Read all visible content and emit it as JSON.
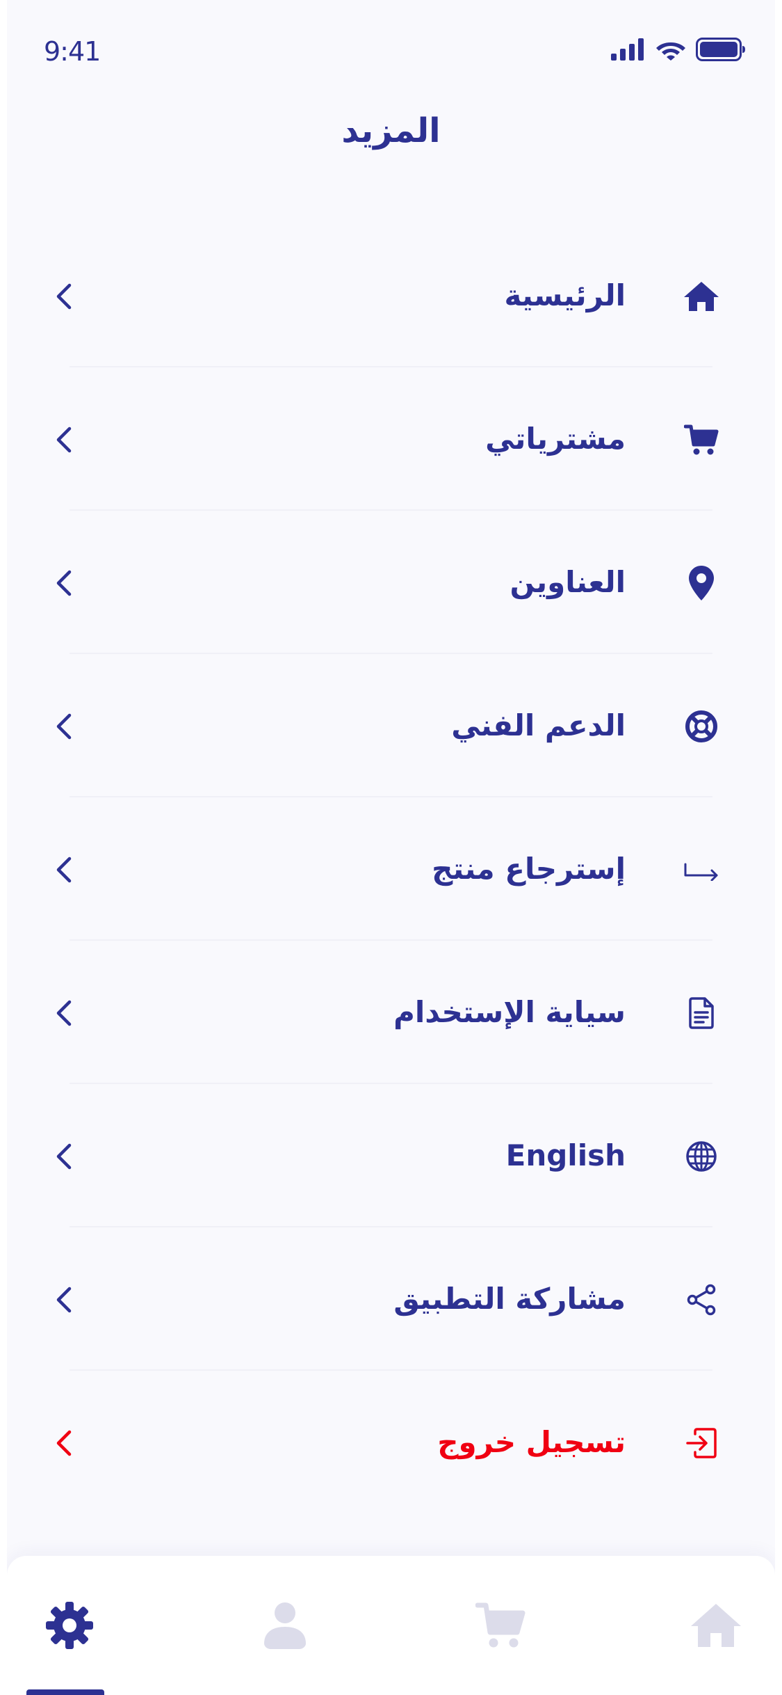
{
  "status_bar": {
    "time": "9:41",
    "signal_icon": "cellular-signal-icon",
    "wifi_icon": "wifi-icon",
    "battery_icon": "battery-icon"
  },
  "header": {
    "title": "المزيد"
  },
  "menu": {
    "items": [
      {
        "label": "الرئيسية",
        "icon": "home-icon"
      },
      {
        "label": "مشترياتي",
        "icon": "cart-icon"
      },
      {
        "label": "العناوين",
        "icon": "location-pin-icon"
      },
      {
        "label": "الدعم الفني",
        "icon": "lifebuoy-icon"
      },
      {
        "label": "إسترجاع منتج",
        "icon": "return-arrow-icon"
      },
      {
        "label": "سياية الإستخدام",
        "icon": "document-icon"
      },
      {
        "label": "English",
        "icon": "globe-icon"
      },
      {
        "label": "مشاركة التطبيق",
        "icon": "share-icon"
      },
      {
        "label": "تسجيل خروج",
        "icon": "logout-icon"
      }
    ]
  },
  "tab_bar": {
    "tabs": [
      {
        "icon": "settings-gear-icon",
        "active": true
      },
      {
        "icon": "profile-icon",
        "active": false
      },
      {
        "icon": "cart-icon",
        "active": false
      },
      {
        "icon": "home-icon",
        "active": false
      }
    ]
  },
  "colors": {
    "primary": "#2d3192",
    "danger": "#f00012",
    "inactive": "#dcdcea",
    "background": "#f9f9fd"
  }
}
